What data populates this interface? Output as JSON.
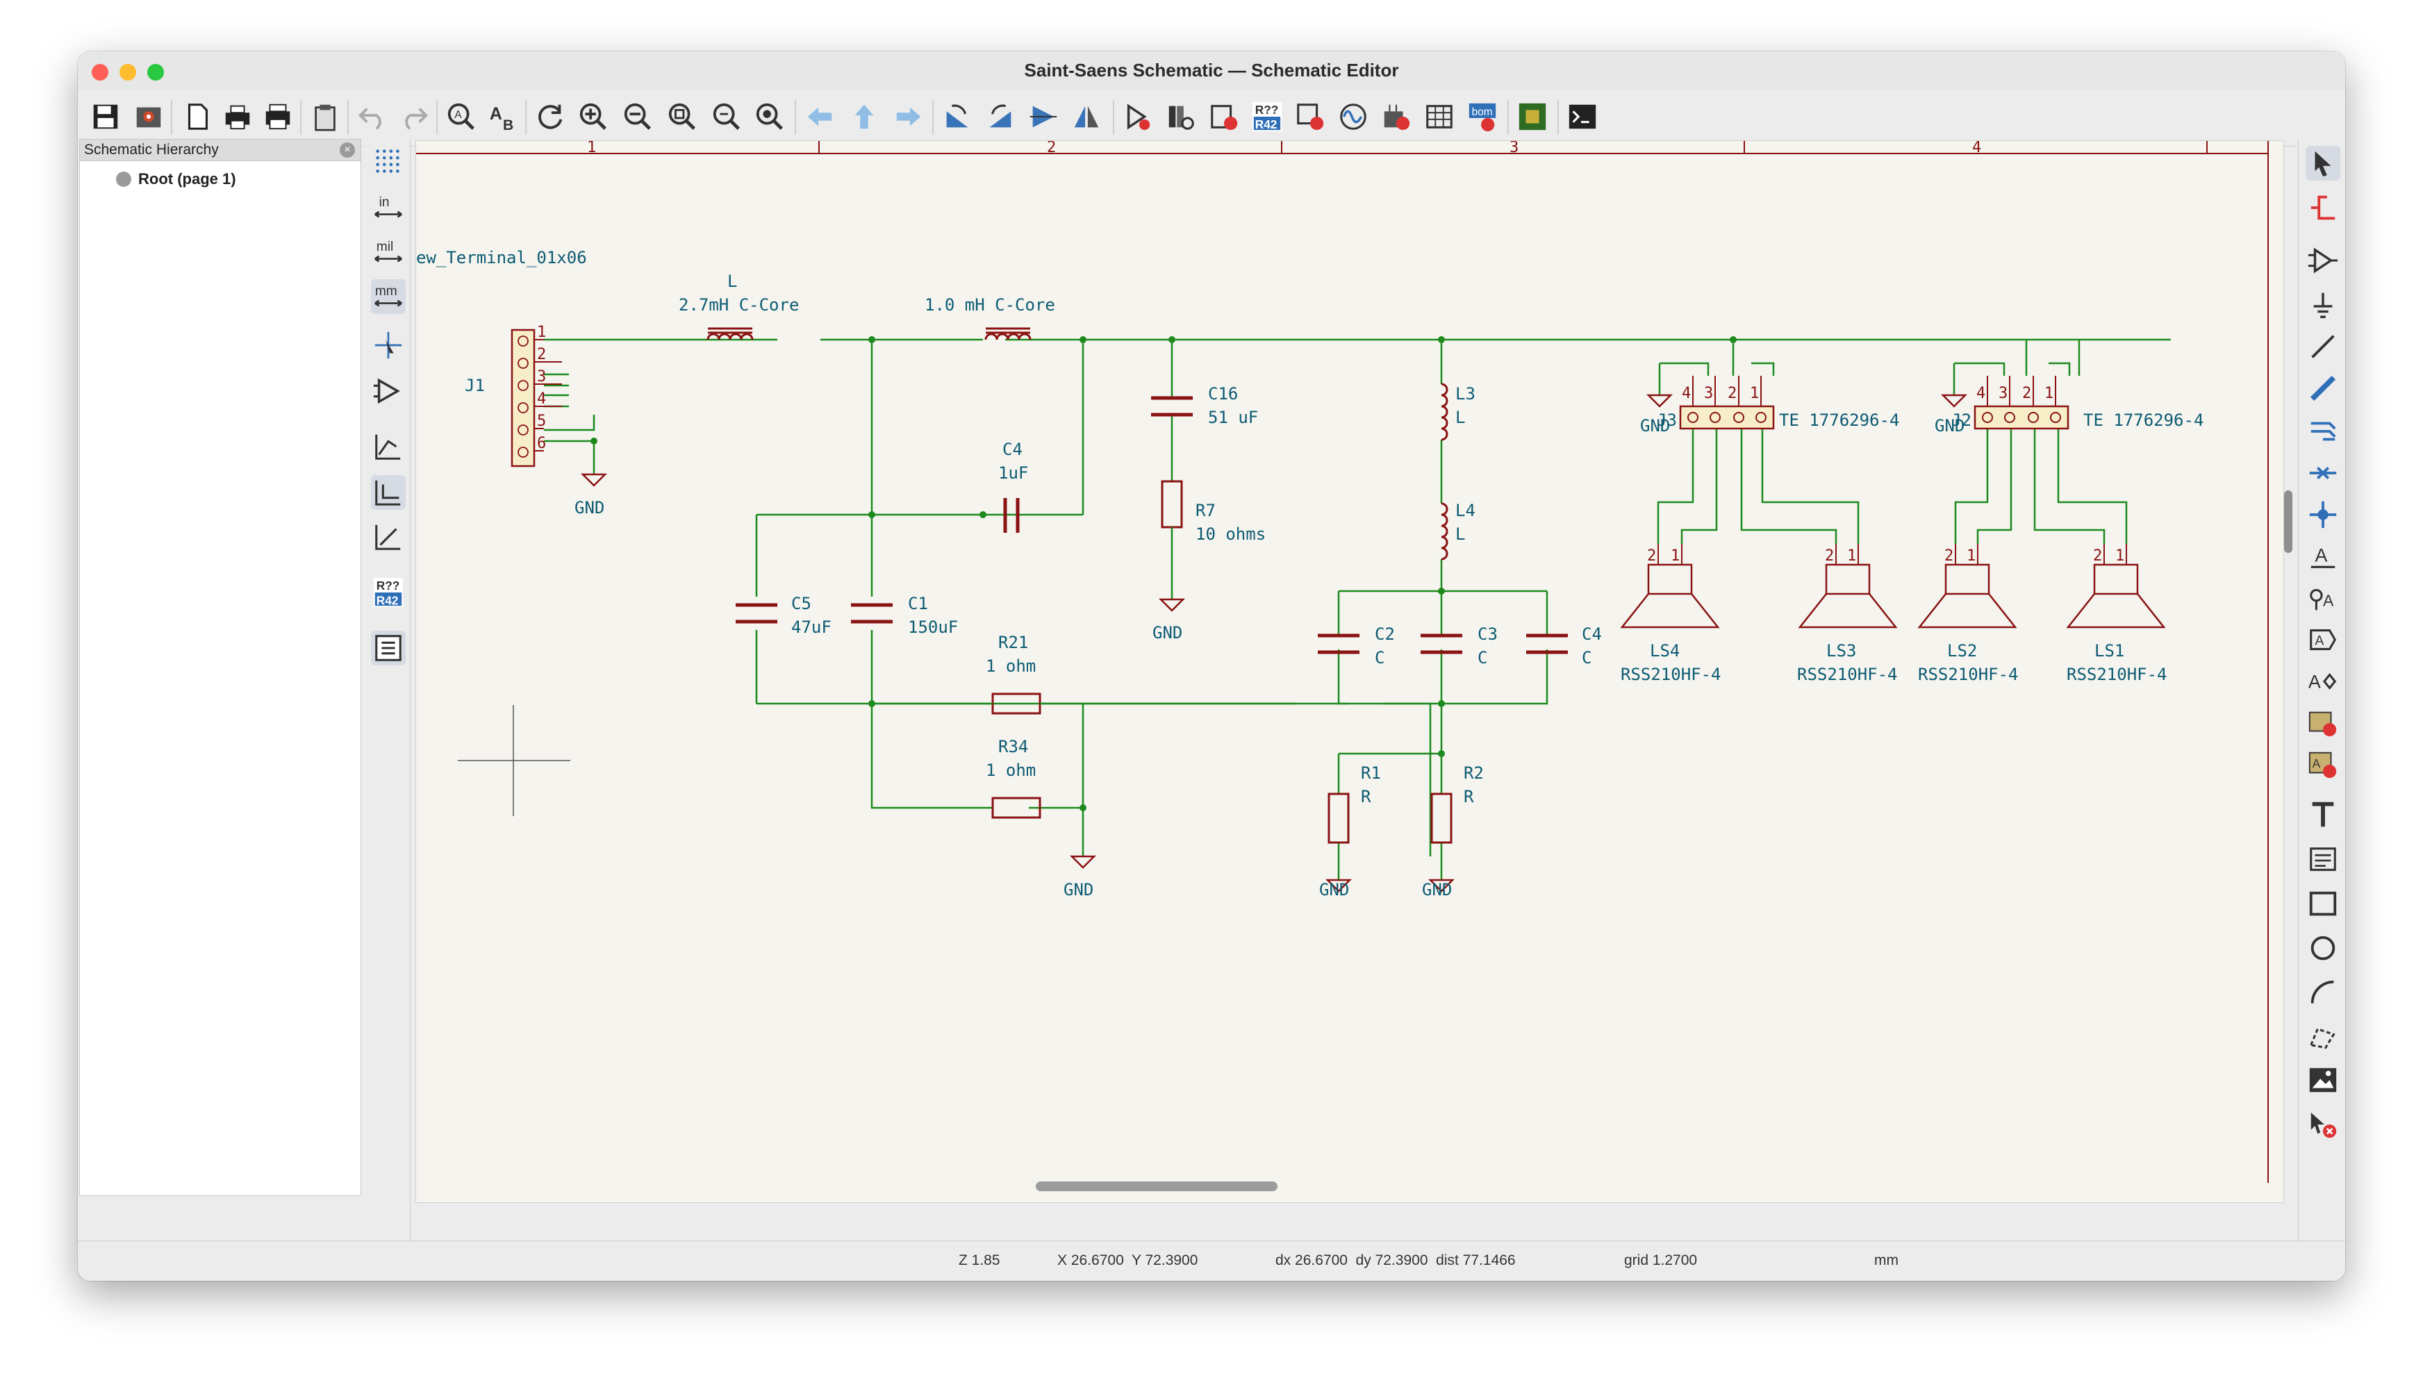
{
  "window": {
    "title": "Saint-Saens Schematic — Schematic Editor"
  },
  "hierarchy_panel": {
    "title": "Schematic Hierarchy",
    "root_item": "Root (page 1)"
  },
  "status": {
    "zoom": "Z 1.85",
    "xy": "X 26.6700  Y 72.3900",
    "delta": "dx 26.6700  dy 72.3900  dist 77.1466",
    "grid": "grid 1.2700",
    "units": "mm"
  },
  "left_toolbar": {
    "unit_in": "in",
    "unit_mil": "mil",
    "unit_mm": "mm",
    "annotate_top": "R??",
    "annotate_bottom": "R42"
  },
  "top_toolbar": {
    "annotate_top": "R??",
    "annotate_bottom": "R42",
    "bom_label": "bom"
  },
  "schematic": {
    "frame_numbers": [
      "1",
      "2",
      "3",
      "4"
    ],
    "labels": {
      "j1_value": "ew_Terminal_01x06",
      "j1_ref": "J1",
      "j1_pins": [
        "1",
        "2",
        "3",
        "4",
        "5",
        "6"
      ],
      "l_ref": "L",
      "l_value": "2.7mH C-Core",
      "l2_value": "1.0 mH C-Core",
      "c4a_ref": "C4",
      "c4a_value": "1uF",
      "c16_ref": "C16",
      "c16_value": "51 uF",
      "r7_ref": "R7",
      "r7_value": "10 ohms",
      "c5_ref": "C5",
      "c5_value": "47uF",
      "c1_ref": "C1",
      "c1_value": "150uF",
      "r21_ref": "R21",
      "r21_value": "1 ohm",
      "r34_ref": "R34",
      "r34_value": "1 ohm",
      "l3_ref": "L3",
      "l3_value": "L",
      "l4_ref": "L4",
      "l4_value": "L",
      "c2_ref": "C2",
      "c2_value": "C",
      "c3_ref": "C3",
      "c3_value": "C",
      "c4b_ref": "C4",
      "c4b_value": "C",
      "r1_ref": "R1",
      "r1_value": "R",
      "r2_ref": "R2",
      "r2_value": "R",
      "j3_ref": "J3",
      "j3_value": "TE 1776296-4",
      "j2_ref": "J2",
      "j2_value": "TE 1776296-4",
      "conn_pins": [
        "4",
        "3",
        "2",
        "1"
      ],
      "ls_pins": [
        "2",
        "1"
      ],
      "ls4_ref": "LS4",
      "ls3_ref": "LS3",
      "ls2_ref": "LS2",
      "ls1_ref": "LS1",
      "ls_value": "RSS210HF-4",
      "gnd": "GND"
    }
  },
  "colors": {
    "wire": "#1c8a1c",
    "component": "#8a1212",
    "text": "#0d5b73",
    "canvas": "#f5f4ef"
  },
  "icons": [
    "save-icon",
    "settings-icon",
    "new-page-icon",
    "print-icon",
    "plot-icon",
    "paste-icon",
    "undo-icon",
    "redo-icon",
    "find-icon",
    "find-replace-icon",
    "refresh-icon",
    "zoom-in-icon",
    "zoom-out-icon",
    "zoom-fit-icon",
    "zoom-objects-icon",
    "zoom-selection-icon",
    "back-icon",
    "up-icon",
    "forward-icon",
    "rotate-ccw-icon",
    "rotate-cw-icon",
    "mirror-v-icon",
    "mirror-h-icon",
    "symbol-editor-icon",
    "library-browser-icon",
    "footprint-assign-icon",
    "annotate-icon",
    "erc-icon",
    "simulator-icon",
    "bom-icon",
    "pcb-icon",
    "scripting-icon"
  ]
}
